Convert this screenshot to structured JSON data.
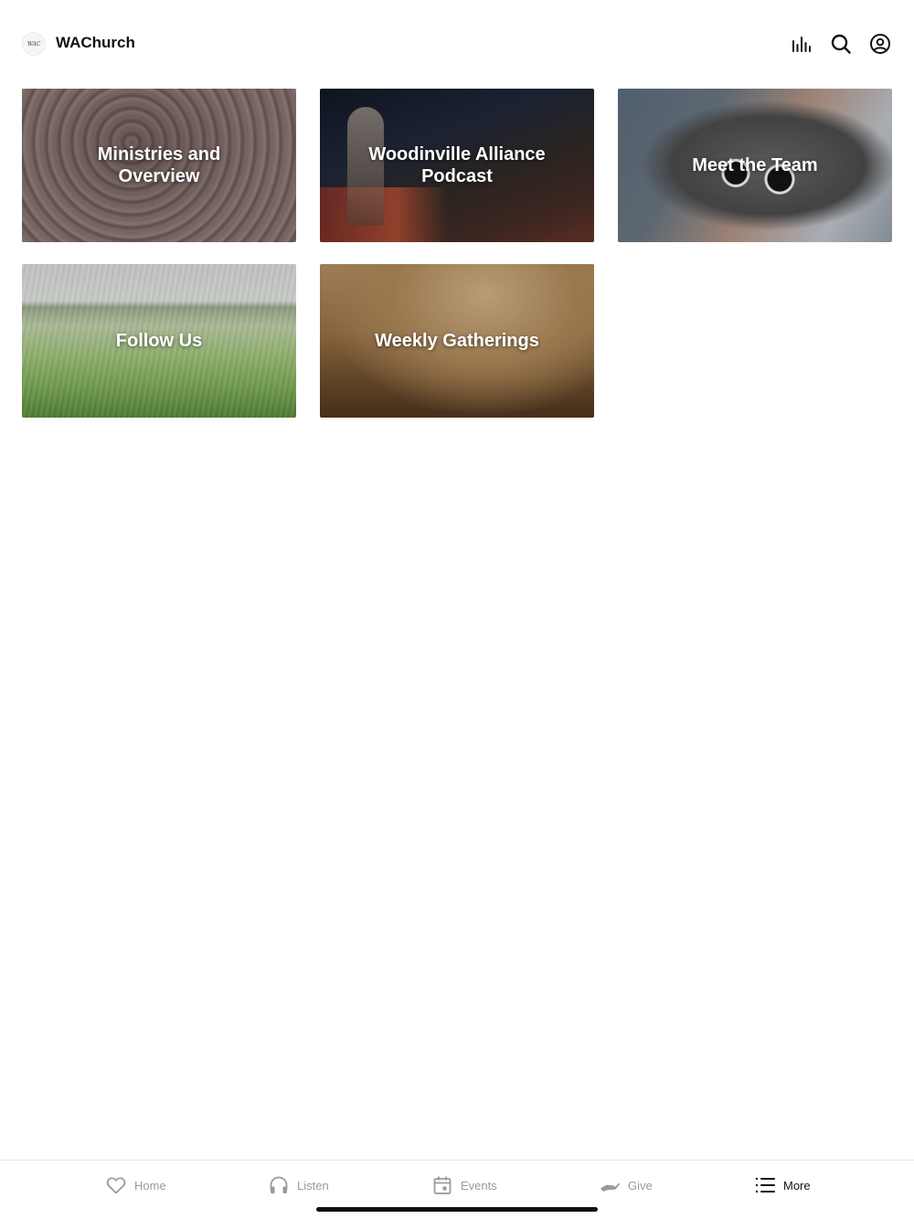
{
  "header": {
    "logo_text": "WAC",
    "title": "WAChurch",
    "icons": [
      "equalizer-icon",
      "search-icon",
      "account-icon"
    ]
  },
  "tiles": [
    {
      "label": "Ministries and Overview",
      "image": "tree-rings-photo"
    },
    {
      "label": "Woodinville Alliance Podcast",
      "image": "worship-stage-photo"
    },
    {
      "label": "Meet the Team",
      "image": "coffee-table-hands-photo"
    },
    {
      "label": "Follow Us",
      "image": "wheat-field-photo"
    },
    {
      "label": "Weekly Gatherings",
      "image": "dusty-field-photo"
    }
  ],
  "tabbar": {
    "items": [
      {
        "label": "Home",
        "icon": "heart-icon",
        "active": false
      },
      {
        "label": "Listen",
        "icon": "headphones-icon",
        "active": false
      },
      {
        "label": "Events",
        "icon": "calendar-icon",
        "active": false
      },
      {
        "label": "Give",
        "icon": "giving-hand-icon",
        "active": false
      },
      {
        "label": "More",
        "icon": "list-icon",
        "active": true
      }
    ]
  },
  "colors": {
    "active_tab": "#111111",
    "inactive_tab": "#9a9a9a",
    "tile_text": "#ffffff"
  }
}
